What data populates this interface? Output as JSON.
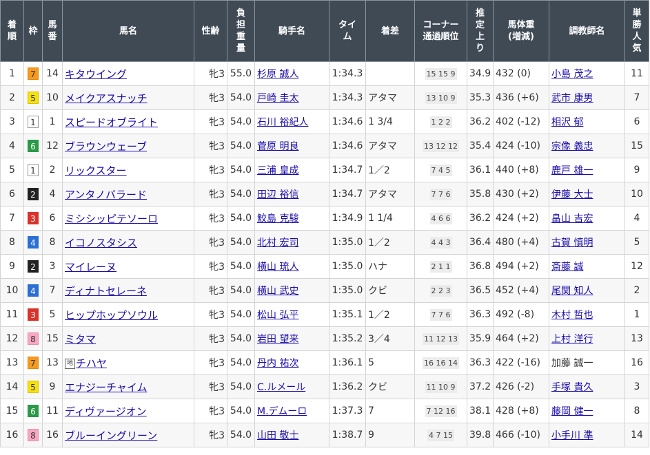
{
  "headers": {
    "rank": [
      "着",
      "順"
    ],
    "waku": [
      "枠"
    ],
    "umaban": [
      "馬",
      "番"
    ],
    "horse": [
      "馬名"
    ],
    "sexage": [
      "性齢"
    ],
    "weight": [
      "負",
      "担",
      "重",
      "量"
    ],
    "jockey": [
      "騎手名"
    ],
    "time": [
      "タイ",
      "ム"
    ],
    "margin": [
      "着差"
    ],
    "corner": [
      "コーナー",
      "通過順位"
    ],
    "last3f": [
      "推",
      "定",
      "上",
      "り"
    ],
    "bodyweight": [
      "馬体重",
      "(増減)"
    ],
    "trainer": [
      "調教師名"
    ],
    "popularity": [
      "単",
      "勝",
      "人",
      "気"
    ]
  },
  "waku_colors": {
    "1": {
      "bg": "#ffffff",
      "fg": "#333333",
      "border": "#999999"
    },
    "2": {
      "bg": "#222222",
      "fg": "#ffffff",
      "border": "#222222"
    },
    "3": {
      "bg": "#d9332b",
      "fg": "#ffffff",
      "border": "#d9332b"
    },
    "4": {
      "bg": "#2a6fd1",
      "fg": "#ffffff",
      "border": "#2a6fd1"
    },
    "5": {
      "bg": "#f7e10c",
      "fg": "#333333",
      "border": "#d8c200"
    },
    "6": {
      "bg": "#2b9a48",
      "fg": "#ffffff",
      "border": "#2b9a48"
    },
    "7": {
      "bg": "#f59a1e",
      "fg": "#333333",
      "border": "#e08a10"
    },
    "8": {
      "bg": "#f7a7c0",
      "fg": "#333333",
      "border": "#e890ad"
    }
  },
  "chiho_label": "地",
  "rows": [
    {
      "rank": "1",
      "waku": "7",
      "umaban": "14",
      "horse": "キタウイング",
      "chiho": false,
      "sexage": "牝3",
      "weight": "55.0",
      "jockey": "杉原 誠人",
      "time": "1:34.3",
      "margin": "",
      "corner": "15 15 9",
      "last3f": "34.9",
      "bodyweight": "432 (0)",
      "trainer": "小島 茂之",
      "trainer_link": true,
      "popularity": "11"
    },
    {
      "rank": "2",
      "waku": "5",
      "umaban": "10",
      "horse": "メイクアスナッチ",
      "chiho": false,
      "sexage": "牝3",
      "weight": "54.0",
      "jockey": "戸崎 圭太",
      "time": "1:34.3",
      "margin": "アタマ",
      "corner": "13 10 9",
      "last3f": "35.3",
      "bodyweight": "436 (+6)",
      "trainer": "武市 康男",
      "trainer_link": true,
      "popularity": "7"
    },
    {
      "rank": "3",
      "waku": "1",
      "umaban": "1",
      "horse": "スピードオブライト",
      "chiho": false,
      "sexage": "牝3",
      "weight": "54.0",
      "jockey": "石川 裕紀人",
      "time": "1:34.6",
      "margin": "1 3/4",
      "corner": "1 2 2",
      "last3f": "36.2",
      "bodyweight": "402 (-12)",
      "trainer": "相沢 郁",
      "trainer_link": true,
      "popularity": "6"
    },
    {
      "rank": "4",
      "waku": "6",
      "umaban": "12",
      "horse": "ブラウンウェーブ",
      "chiho": false,
      "sexage": "牝3",
      "weight": "54.0",
      "jockey": "菅原 明良",
      "time": "1:34.6",
      "margin": "アタマ",
      "corner": "13 12 12",
      "last3f": "35.4",
      "bodyweight": "424 (-10)",
      "trainer": "宗像 義忠",
      "trainer_link": true,
      "popularity": "15"
    },
    {
      "rank": "5",
      "waku": "1",
      "umaban": "2",
      "horse": "リックスター",
      "chiho": false,
      "sexage": "牝3",
      "weight": "54.0",
      "jockey": "三浦 皇成",
      "time": "1:34.7",
      "margin": "1／2",
      "corner": "7 4 5",
      "last3f": "36.1",
      "bodyweight": "440 (+8)",
      "trainer": "鹿戸 雄一",
      "trainer_link": true,
      "popularity": "9"
    },
    {
      "rank": "6",
      "waku": "2",
      "umaban": "4",
      "horse": "アンタノバラード",
      "chiho": false,
      "sexage": "牝3",
      "weight": "54.0",
      "jockey": "田辺 裕信",
      "time": "1:34.7",
      "margin": "アタマ",
      "corner": "7 7 6",
      "last3f": "35.8",
      "bodyweight": "430 (+2)",
      "trainer": "伊藤 大士",
      "trainer_link": true,
      "popularity": "10"
    },
    {
      "rank": "7",
      "waku": "3",
      "umaban": "6",
      "horse": "ミシシッピテソーロ",
      "chiho": false,
      "sexage": "牝3",
      "weight": "54.0",
      "jockey": "鮫島 克駿",
      "time": "1:34.9",
      "margin": "1 1/4",
      "corner": "4 6 6",
      "last3f": "36.2",
      "bodyweight": "424 (+2)",
      "trainer": "畠山 吉宏",
      "trainer_link": true,
      "popularity": "4"
    },
    {
      "rank": "8",
      "waku": "4",
      "umaban": "8",
      "horse": "イコノスタシス",
      "chiho": false,
      "sexage": "牝3",
      "weight": "54.0",
      "jockey": "北村 宏司",
      "time": "1:35.0",
      "margin": "1／2",
      "corner": "4 4 3",
      "last3f": "36.4",
      "bodyweight": "480 (+4)",
      "trainer": "古賀 慎明",
      "trainer_link": true,
      "popularity": "5"
    },
    {
      "rank": "9",
      "waku": "2",
      "umaban": "3",
      "horse": "マイレーヌ",
      "chiho": false,
      "sexage": "牝3",
      "weight": "54.0",
      "jockey": "横山 琉人",
      "time": "1:35.0",
      "margin": "ハナ",
      "corner": "2 1 1",
      "last3f": "36.8",
      "bodyweight": "494 (+2)",
      "trainer": "斎藤 誠",
      "trainer_link": true,
      "popularity": "12"
    },
    {
      "rank": "10",
      "waku": "4",
      "umaban": "7",
      "horse": "ディナトセレーネ",
      "chiho": false,
      "sexage": "牝3",
      "weight": "54.0",
      "jockey": "横山 武史",
      "time": "1:35.0",
      "margin": "クビ",
      "corner": "2 2 3",
      "last3f": "36.5",
      "bodyweight": "452 (+4)",
      "trainer": "尾関 知人",
      "trainer_link": true,
      "popularity": "2"
    },
    {
      "rank": "11",
      "waku": "3",
      "umaban": "5",
      "horse": "ヒップホップソウル",
      "chiho": false,
      "sexage": "牝3",
      "weight": "54.0",
      "jockey": "松山 弘平",
      "time": "1:35.1",
      "margin": "1／2",
      "corner": "7 7 6",
      "last3f": "36.3",
      "bodyweight": "492 (-8)",
      "trainer": "木村 哲也",
      "trainer_link": true,
      "popularity": "1"
    },
    {
      "rank": "12",
      "waku": "8",
      "umaban": "15",
      "horse": "ミタマ",
      "chiho": false,
      "sexage": "牝3",
      "weight": "54.0",
      "jockey": "岩田 望来",
      "time": "1:35.2",
      "margin": "3／4",
      "corner": "11 12 13",
      "last3f": "35.9",
      "bodyweight": "464 (+2)",
      "trainer": "上村 洋行",
      "trainer_link": true,
      "popularity": "13"
    },
    {
      "rank": "13",
      "waku": "7",
      "umaban": "13",
      "horse": "チハヤ",
      "chiho": true,
      "sexage": "牝3",
      "weight": "54.0",
      "jockey": "丹内 祐次",
      "time": "1:36.1",
      "margin": "5",
      "corner": "16 16 14",
      "last3f": "36.3",
      "bodyweight": "422 (-16)",
      "trainer": "加藤 誠一",
      "trainer_link": false,
      "popularity": "16"
    },
    {
      "rank": "14",
      "waku": "5",
      "umaban": "9",
      "horse": "エナジーチャイム",
      "chiho": false,
      "sexage": "牝3",
      "weight": "54.0",
      "jockey": "C.ルメール",
      "time": "1:36.2",
      "margin": "クビ",
      "corner": "11 10 9",
      "last3f": "37.2",
      "bodyweight": "426 (-2)",
      "trainer": "手塚 貴久",
      "trainer_link": true,
      "popularity": "3"
    },
    {
      "rank": "15",
      "waku": "6",
      "umaban": "11",
      "horse": "ディヴァージオン",
      "chiho": false,
      "sexage": "牝3",
      "weight": "54.0",
      "jockey": "M.デムーロ",
      "time": "1:37.3",
      "margin": "7",
      "corner": "7 12 16",
      "last3f": "38.1",
      "bodyweight": "428 (+8)",
      "trainer": "藤岡 健一",
      "trainer_link": true,
      "popularity": "8"
    },
    {
      "rank": "16",
      "waku": "8",
      "umaban": "16",
      "horse": "ブルーイングリーン",
      "chiho": false,
      "sexage": "牝3",
      "weight": "54.0",
      "jockey": "山田 敬士",
      "time": "1:38.7",
      "margin": "9",
      "corner": "4 7 15",
      "last3f": "39.8",
      "bodyweight": "466 (-10)",
      "trainer": "小手川 準",
      "trainer_link": true,
      "popularity": "14"
    }
  ]
}
